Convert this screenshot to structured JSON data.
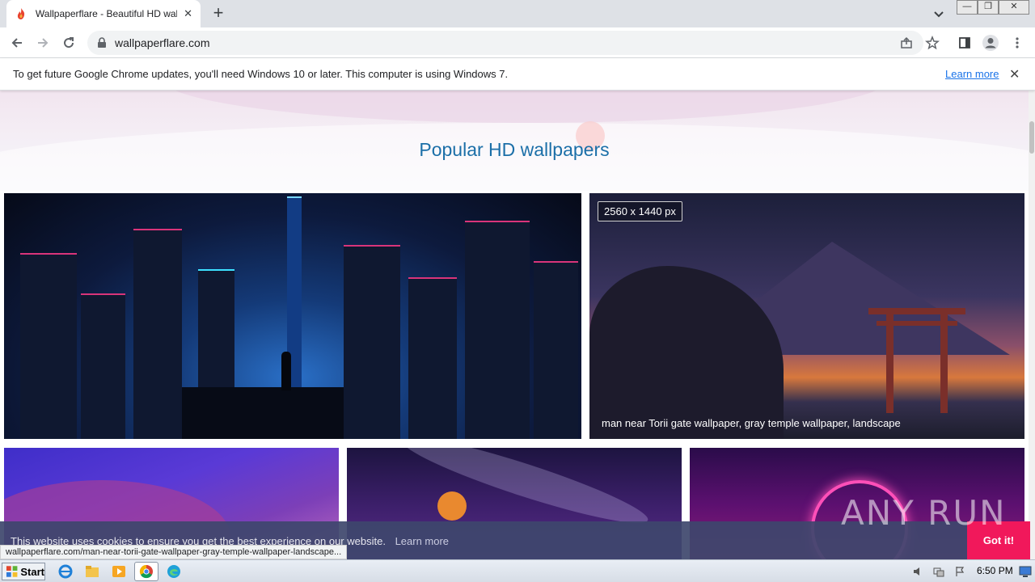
{
  "browser": {
    "tab_title": "Wallpaperflare - Beautiful HD wallpap",
    "url": "wallpaperflare.com",
    "new_tab": "+",
    "tab_close": "✕"
  },
  "infobar": {
    "message": "To get future Google Chrome updates, you'll need Windows 10 or later. This computer is using Windows 7.",
    "learn_more": "Learn more",
    "close": "✕"
  },
  "page": {
    "heading": "Popular HD wallpapers",
    "featured": {
      "size_label": "2560 x 1440 px",
      "caption": "man near Torii gate wallpaper, gray temple wallpaper, landscape"
    }
  },
  "cookie": {
    "text": "This website uses cookies to ensure you get the best experience on our website.",
    "learn_more": "Learn more",
    "accept": "Got it!"
  },
  "status_url": "wallpaperflare.com/man-near-torii-gate-wallpaper-gray-temple-wallpaper-landscape...",
  "watermark": "ANY RUN",
  "taskbar": {
    "start": "Start",
    "clock": "6:50 PM"
  },
  "colors": {
    "heading": "#1b6fa8",
    "accent_button": "#f1185b",
    "cookie_bg": "#3e466c",
    "link": "#1a73e8"
  }
}
